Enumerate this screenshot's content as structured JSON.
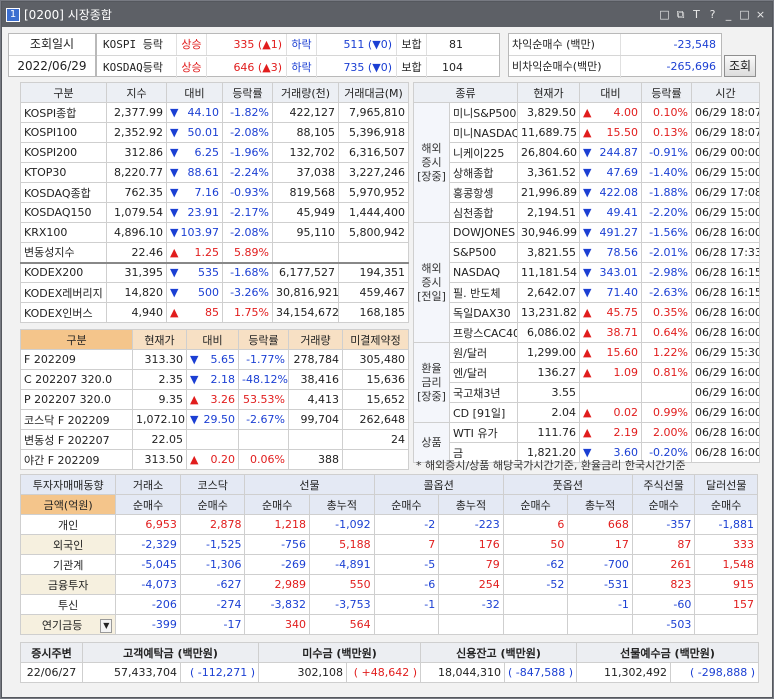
{
  "window": {
    "number": "1",
    "title": "[0200] 시장종합",
    "controls": [
      "□",
      "⧉",
      "T",
      "?",
      "_",
      "□",
      "×"
    ]
  },
  "inquiry": {
    "label_time": "조회일시",
    "date": "2022/06/29",
    "rows": [
      {
        "name": "KOSPI 등락",
        "up_label": "상승",
        "up_value": "335",
        "up_arrow": "▲",
        "up_count": "1",
        "down_label": "하락",
        "down_value": "511",
        "down_arrow": "▼",
        "down_count": "0",
        "flat_label": "보합",
        "flat_value": "81"
      },
      {
        "name": "KOSDAQ등락",
        "up_label": "상승",
        "up_value": "646",
        "up_arrow": "▲",
        "up_count": "3",
        "down_label": "하락",
        "down_value": "735",
        "down_arrow": "▼",
        "down_count": "0",
        "flat_label": "보합",
        "flat_value": "104"
      }
    ],
    "net": [
      {
        "label": "차익순매수 (백만)",
        "value": "-23,548"
      },
      {
        "label": "비차익순매수(백만)",
        "value": "-265,696"
      }
    ],
    "query_button": "조회"
  },
  "index_table": {
    "headers": [
      "구분",
      "지수",
      "대비",
      "등락률",
      "거래량(천)",
      "거래대금(M)"
    ],
    "rows": [
      [
        "KOSPI종합",
        "2,377.99",
        "▼",
        "44.10",
        "-1.82%",
        "422,127",
        "7,965,810"
      ],
      [
        "KOSPI100",
        "2,352.92",
        "▼",
        "50.01",
        "-2.08%",
        "88,105",
        "5,396,918"
      ],
      [
        "KOSPI200",
        "312.86",
        "▼",
        "6.25",
        "-1.96%",
        "132,702",
        "6,316,507"
      ],
      [
        "KTOP30",
        "8,220.77",
        "▼",
        "88.61",
        "-2.24%",
        "37,038",
        "3,227,246"
      ],
      [
        "KOSDAQ종합",
        "762.35",
        "▼",
        "7.16",
        "-0.93%",
        "819,568",
        "5,970,952"
      ],
      [
        "KOSDAQ150",
        "1,079.54",
        "▼",
        "23.91",
        "-2.17%",
        "45,949",
        "1,444,400"
      ],
      [
        "KRX100",
        "4,896.10",
        "▼",
        "103.97",
        "-2.08%",
        "95,110",
        "5,800,942"
      ],
      [
        "변동성지수",
        "22.46",
        "▲",
        "1.25",
        "5.89%",
        "",
        ""
      ],
      [
        "KODEX200",
        "31,395",
        "▼",
        "535",
        "-1.68%",
        "6,177,527",
        "194,351"
      ],
      [
        "KODEX레버리지",
        "14,820",
        "▼",
        "500",
        "-3.26%",
        "30,816,921",
        "459,467"
      ],
      [
        "KODEX인버스",
        "4,940",
        "▲",
        "85",
        "1.75%",
        "34,154,672",
        "168,185"
      ]
    ]
  },
  "futures_table": {
    "headers": [
      "구분",
      "현재가",
      "대비",
      "등락률",
      "거래량",
      "미결제약정"
    ],
    "rows": [
      [
        "F 202209",
        "313.30",
        "▼",
        "5.65",
        "-1.77%",
        "278,784",
        "305,480"
      ],
      [
        "C 202207 320.0",
        "2.35",
        "▼",
        "2.18",
        "-48.12%",
        "38,416",
        "15,636"
      ],
      [
        "P 202207 320.0",
        "9.35",
        "▲",
        "3.26",
        "53.53%",
        "4,413",
        "15,652"
      ],
      [
        "코스닥 F 202209",
        "1,072.10",
        "▼",
        "29.50",
        "-2.67%",
        "99,704",
        "262,648"
      ],
      [
        "변동성 F 202207",
        "22.05",
        "",
        "",
        "",
        "",
        "24"
      ],
      [
        "야간 F 202209",
        "313.50",
        "▲",
        "0.20",
        "0.06%",
        "388",
        ""
      ]
    ]
  },
  "overseas_table": {
    "headers": [
      "종류",
      "현재가",
      "대비",
      "등락률",
      "시간"
    ],
    "groups": [
      {
        "label": "해외\n증시\n[장중]",
        "rows": [
          [
            "미니S&P500",
            "3,829.50",
            "▲",
            "4.00",
            "0.10%",
            "06/29 18:07"
          ],
          [
            "미니NASDAQ",
            "11,689.75",
            "▲",
            "15.50",
            "0.13%",
            "06/29 18:07"
          ],
          [
            "니케이225",
            "26,804.60",
            "▼",
            "244.87",
            "-0.91%",
            "06/29 00:00"
          ],
          [
            "상해종합",
            "3,361.52",
            "▼",
            "47.69",
            "-1.40%",
            "06/29 15:00"
          ],
          [
            "홍콩항셍",
            "21,996.89",
            "▼",
            "422.08",
            "-1.88%",
            "06/29 17:08"
          ],
          [
            "심천종합",
            "2,194.51",
            "▼",
            "49.41",
            "-2.20%",
            "06/29 15:00"
          ]
        ]
      },
      {
        "label": "해외\n증시\n[전일]",
        "rows": [
          [
            "DOWJONES",
            "30,946.99",
            "▼",
            "491.27",
            "-1.56%",
            "06/28 16:00"
          ],
          [
            "S&P500",
            "3,821.55",
            "▼",
            "78.56",
            "-2.01%",
            "06/28 17:33"
          ],
          [
            "NASDAQ",
            "11,181.54",
            "▼",
            "343.01",
            "-2.98%",
            "06/28 16:15"
          ],
          [
            "필. 반도체",
            "2,642.07",
            "▼",
            "71.40",
            "-2.63%",
            "06/28 16:15"
          ],
          [
            "독일DAX30",
            "13,231.82",
            "▲",
            "45.75",
            "0.35%",
            "06/28 16:00"
          ],
          [
            "프랑스CAC40",
            "6,086.02",
            "▲",
            "38.71",
            "0.64%",
            "06/28 16:00"
          ]
        ]
      },
      {
        "label": "환율\n금리\n[장중]",
        "rows": [
          [
            "원/달러",
            "1,299.00",
            "▲",
            "15.60",
            "1.22%",
            "06/29 15:30"
          ],
          [
            "엔/달러",
            "136.27",
            "▲",
            "1.09",
            "0.81%",
            "06/29 16:00"
          ],
          [
            "국고채3년",
            "3.55",
            "",
            "",
            "",
            "06/29 16:00"
          ],
          [
            "CD [91일]",
            "2.04",
            "▲",
            "0.02",
            "0.99%",
            "06/29 16:00"
          ]
        ]
      },
      {
        "label": "상품",
        "rows": [
          [
            "WTI 유가",
            "111.76",
            "▲",
            "2.19",
            "2.00%",
            "06/28 16:00"
          ],
          [
            "금",
            "1,821.20",
            "▼",
            "3.60",
            "-0.20%",
            "06/28 16:00"
          ]
        ]
      }
    ],
    "note": "* 해외증시/상품 해당국가시간기준, 환율금리 한국시간기준"
  },
  "investor_table": {
    "group_headers": [
      "투자자매매동향",
      "거래소",
      "코스닥",
      "선물",
      "콜옵션",
      "풋옵션",
      "주식선물",
      "달러선물"
    ],
    "sub_headers": [
      "금액(억원)",
      "순매수",
      "순매수",
      "순매수",
      "총누적",
      "순매수",
      "총누적",
      "순매수",
      "총누적",
      "순매수",
      "순매수"
    ],
    "rows": [
      [
        "개인",
        "6,953",
        "2,878",
        "1,218",
        "-1,092",
        "-2",
        "-223",
        "6",
        "668",
        "-357",
        "-1,881"
      ],
      [
        "외국인",
        "-2,329",
        "-1,525",
        "-756",
        "5,188",
        "7",
        "176",
        "50",
        "17",
        "87",
        "333"
      ],
      [
        "기관계",
        "-5,045",
        "-1,306",
        "-269",
        "-4,891",
        "-5",
        "79",
        "-62",
        "-700",
        "261",
        "1,548"
      ],
      [
        "금융투자",
        "-4,073",
        "-627",
        "2,989",
        "550",
        "-6",
        "254",
        "-52",
        "-531",
        "823",
        "915"
      ],
      [
        "투신",
        "-206",
        "-274",
        "-3,832",
        "-3,753",
        "-1",
        "-32",
        "",
        "-1",
        "-60",
        "157"
      ],
      [
        "연기금등",
        "-399",
        "-17",
        "340",
        "564",
        "",
        "",
        "",
        "",
        "-503",
        ""
      ]
    ]
  },
  "bottom_table": {
    "headers": [
      "증시주변",
      "고객예탁금 (백만원)",
      "미수금 (백만원)",
      "신용잔고 (백만원)",
      "선물예수금 (백만원)"
    ],
    "row": {
      "date": "22/06/27",
      "deposit": "57,433,704",
      "deposit_chg": "-112,271",
      "unpaid": "302,108",
      "unpaid_chg": "+48,642",
      "credit": "18,044,310",
      "credit_chg": "-847,588",
      "fut_deposit": "11,302,492",
      "fut_deposit_chg": "-298,888"
    }
  },
  "colors": {
    "up": "#e11d1d",
    "down": "#1b3fd3",
    "titlebar": "#5d6066"
  }
}
